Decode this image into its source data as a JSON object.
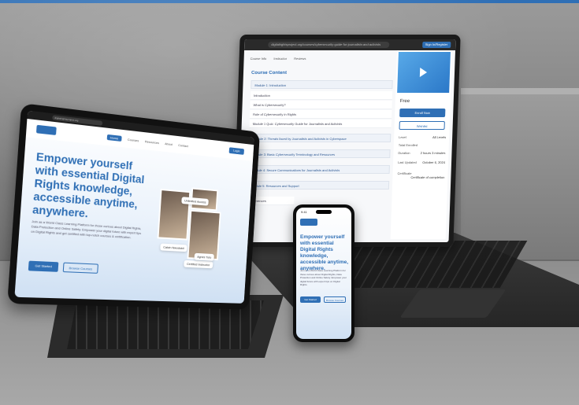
{
  "laptop": {
    "url": "digitalrightsproject.org/courses/cybersecurity-guide-for-journalists-and-activists",
    "signin": "Sign In/Register",
    "tabs": [
      "Course Info",
      "Instructor",
      "Reviews"
    ],
    "course_title": "Course Content",
    "modules": [
      "Module 1: Introduction",
      "Introduction",
      "What is Cybersecurity?",
      "Role of Cybersecurity in Rights",
      "Module 1 Quiz: Cybersecurity Guide for Journalists and Activists",
      "Module 2: Threats faced by Journalists and Activists in Cyberspace",
      "Module 3: Basic Cybersecurity Terminology and Resources",
      "Module 4: Secure Communications for Journalists and Activists",
      "Module 5: Resources and Support"
    ],
    "references": "References",
    "price": "Free",
    "enroll": "Enroll Now",
    "wishlist": "Wishlist",
    "meta": [
      {
        "label": "Level",
        "value": "All Levels"
      },
      {
        "label": "Total Enrolled",
        "value": ""
      },
      {
        "label": "Duration",
        "value": "2 hours 3 minutes"
      },
      {
        "label": "Last Updated",
        "value": "October 6, 2024"
      },
      {
        "label": "Certificate",
        "value": "Certificate of completion"
      }
    ]
  },
  "tablet": {
    "url": "digitalrightsproject.org",
    "menu": [
      "Home",
      "Courses",
      "Resources",
      "About",
      "Contact"
    ],
    "cta": "Login",
    "headline": "Empower yourself with essential Digital Rights knowledge, accessible anytime, anywhere.",
    "desc": "Join as a World Class Learning Platform for those curious about Digital Rights, Data Protection and Online Safety. Empower your digital future with expert tips on Digital Rights and get certified with top-notch courses & certification.",
    "btn_primary": "Get Started",
    "btn_secondary": "Browse Courses",
    "cards": [
      "Unlimited Access",
      "Certified Instructor",
      "Calvin Nwodukit",
      "Agnes Tuto"
    ]
  },
  "phone": {
    "time": "9:41",
    "headline": "Empower yourself with essential Digital Rights knowledge, accessible anytime, anywhere.",
    "desc": "Join as a World Class Learning Platform for those curious about Digital Rights, Data Protection and Online Safety. Empower your digital future with expert tips on Digital Rights.",
    "btn_primary": "Get Started",
    "btn_secondary": "Browse Courses"
  }
}
